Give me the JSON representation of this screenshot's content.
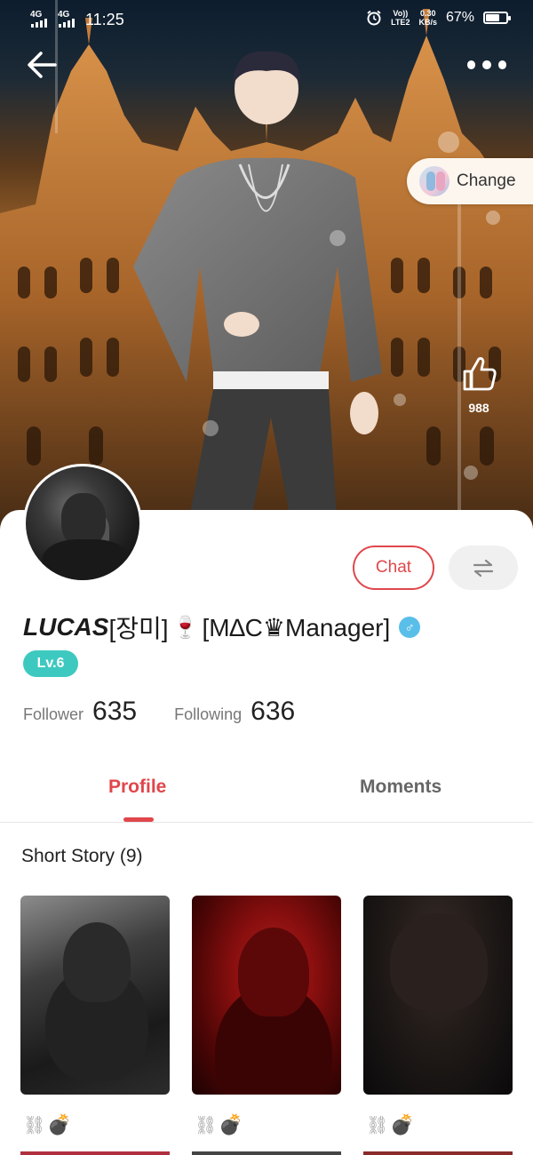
{
  "status_bar": {
    "network_1": "4G",
    "network_2": "4G",
    "time": "11:25",
    "volte_line1": "Vo))",
    "volte_line2": "LTE2",
    "speed_value": "0.30",
    "speed_unit": "KB/s",
    "battery_percent": "67%",
    "battery_level": 0.67,
    "icons": [
      "alarm-icon",
      "signal-icon",
      "battery-icon"
    ]
  },
  "hero": {
    "change_label": "Change",
    "like_count": "988",
    "icons": [
      "back-arrow-icon",
      "more-dots-icon",
      "thumbs-up-icon",
      "outfit-thumbnail-icon"
    ]
  },
  "profile": {
    "name": "LUCAS",
    "name_suffix": "[장미]",
    "emoji": "🍷",
    "title": "[M∆C♛Manager]",
    "gender_symbol": "♂",
    "level": "Lv.6",
    "chat_label": "Chat",
    "stats": {
      "follower_label": "Follower",
      "follower_value": "635",
      "following_label": "Following",
      "following_value": "636"
    }
  },
  "tabs": {
    "profile": "Profile",
    "moments": "Moments",
    "active": "Profile"
  },
  "short_story": {
    "title": "Short Story (9)",
    "items": [
      {
        "chain": "⛓",
        "emoji": "💣"
      },
      {
        "chain": "⛓",
        "emoji": "💣"
      },
      {
        "chain": "⛓",
        "emoji": "💣"
      }
    ]
  },
  "colors": {
    "accent": "#e0474c",
    "level_badge": "#3ec9c0",
    "gender_badge": "#59bfe9"
  }
}
